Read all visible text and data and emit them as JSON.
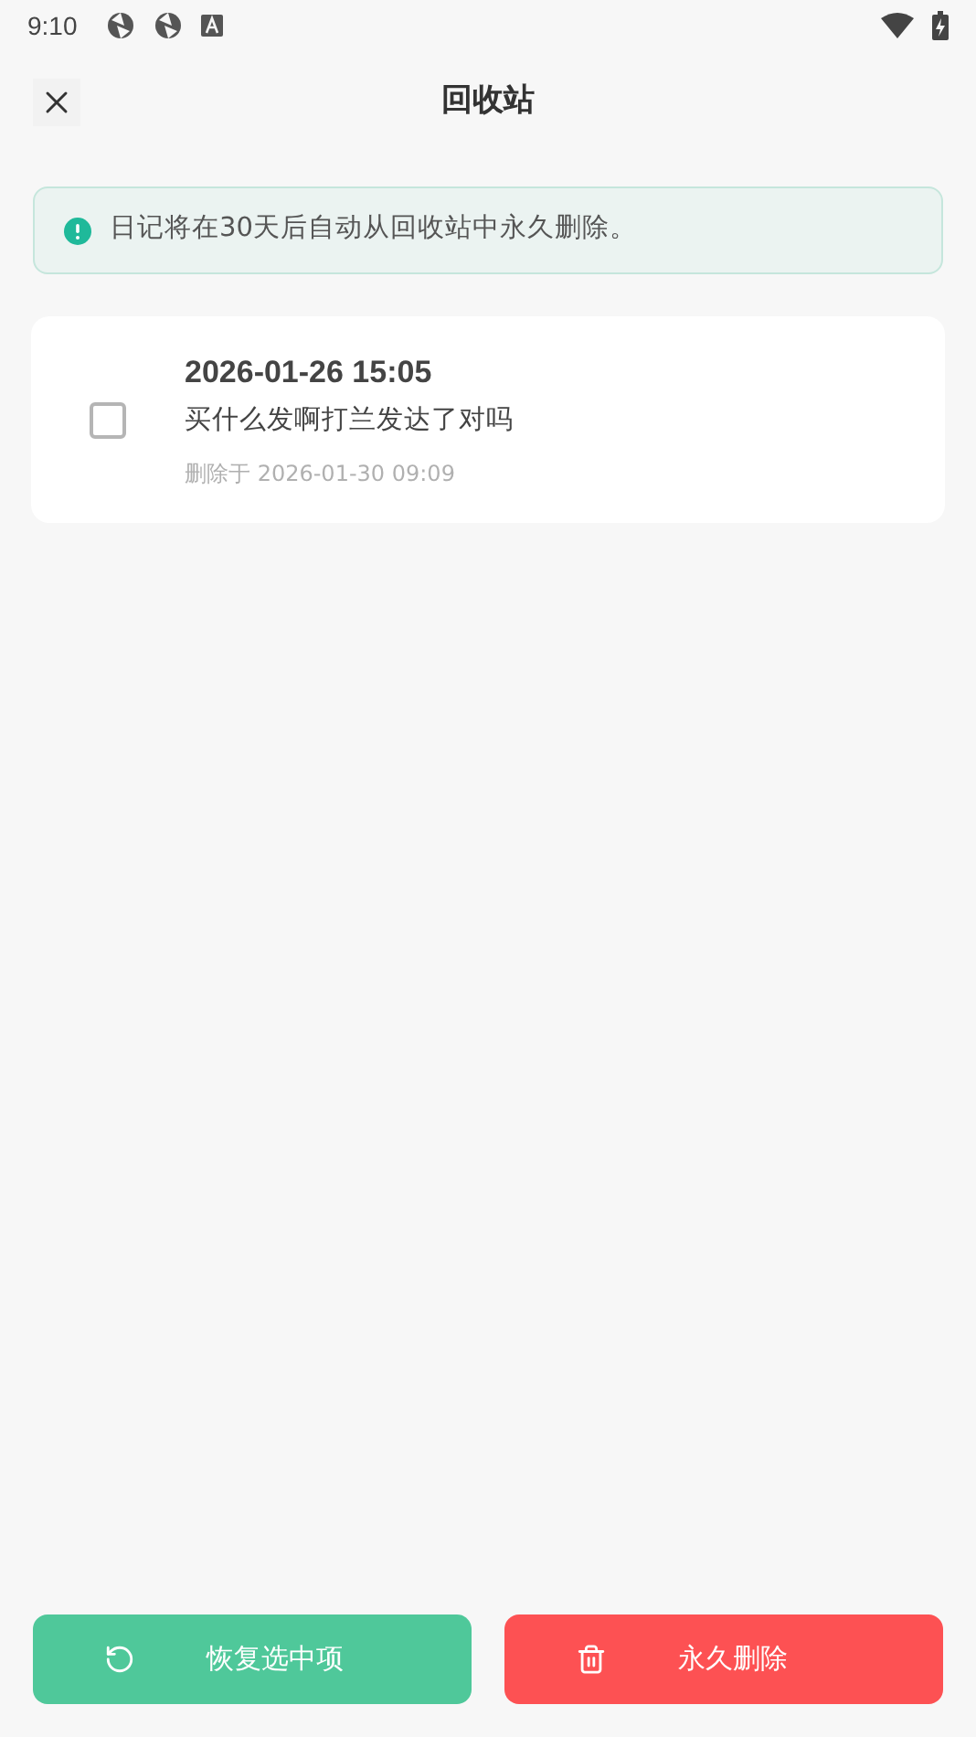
{
  "status_bar": {
    "time": "9:10"
  },
  "header": {
    "title": "回收站"
  },
  "notice": {
    "text": "日记将在30天后自动从回收站中永久删除。"
  },
  "entries": [
    {
      "title": "2026-01-26 15:05",
      "content": "买什么发啊打兰发达了对吗",
      "deleted_at": "删除于 2026-01-30 09:09",
      "checked": false
    }
  ],
  "actions": [
    {
      "kind": "restore",
      "label": "恢复选中项"
    },
    {
      "kind": "delete",
      "label": "永久删除"
    }
  ]
}
